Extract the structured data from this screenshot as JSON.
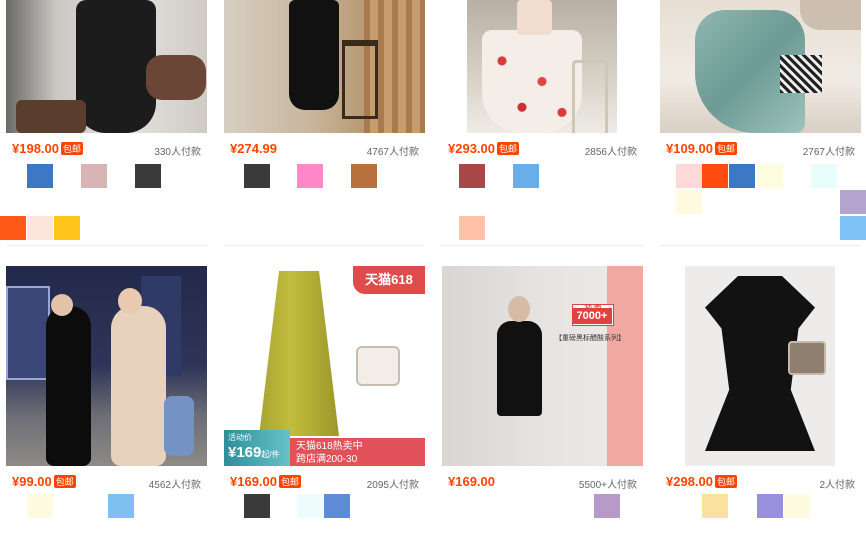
{
  "products": [
    {
      "price": "¥198.00",
      "free_shipping": "包邮",
      "sold": "330人付款",
      "image": "black-wrap-dress-photo",
      "swatch_colors": [
        "#3c78c3",
        "#d8b4b4",
        "#3a3a3a"
      ]
    },
    {
      "price": "¥274.99",
      "free_shipping": "",
      "sold": "4767人付款",
      "image": "black-slim-dress-photo",
      "swatch_colors": [
        "#3a3a3a",
        "#ff88c8",
        "#b8703c"
      ]
    },
    {
      "price": "¥293.00",
      "free_shipping": "包邮",
      "sold": "2856人付款",
      "image": "floral-dress-photo",
      "swatch_colors": [
        "#a94848",
        "#6aaee8"
      ]
    },
    {
      "price": "¥109.00",
      "free_shipping": "包邮",
      "sold": "2767人付款",
      "image": "teal-satin-dress-photo",
      "swatch_colors": [
        "#ffd8d8",
        "#ff4a10",
        "#3c78c3",
        "#fffde0",
        "#e8fcfc",
        "#fffbe0"
      ]
    },
    {
      "price": "¥99.00",
      "free_shipping": "包邮",
      "sold": "4562人付款",
      "image": "night-street-dresses-photo",
      "swatch_colors": [
        "#fffbe0",
        "#7fc0f0"
      ]
    },
    {
      "price": "¥169.00",
      "free_shipping": "包邮",
      "sold": "2095人付款",
      "image": "olive-slip-dress-photo",
      "promo_brand": "天猫618",
      "promo_label": "活动价",
      "promo_price": "¥169",
      "promo_unit": "起/件",
      "promo_line1": "天猫618热卖中",
      "promo_line2": "跨店满200-30",
      "swatch_colors": [
        "#3a3a3a",
        "#eefcfc",
        "#5f8ad6"
      ]
    },
    {
      "price": "¥169.00",
      "free_shipping": "",
      "sold": "5500+人付款",
      "image": "black-mini-dress-photo",
      "hot_label": "热卖",
      "hot_count": "7000+",
      "series_label": "【重磅黑标醋酸系列】",
      "swatch_colors": [
        "#b89ac8"
      ]
    },
    {
      "price": "¥298.00",
      "free_shipping": "包邮",
      "sold": "2人付款",
      "image": "black-ruffle-dress-photo",
      "swatch_colors": [
        "#fbe1a0",
        "#9890dc",
        "#fffbe0"
      ]
    }
  ],
  "row1_extra_swatches": [
    "#ff5a18",
    "#ffe6dc",
    "#ffc41a"
  ],
  "col3_extra_swatch": "#ffc2a8",
  "right_edge_swatches": [
    "#b4a3cf",
    "#7fc2f5"
  ]
}
